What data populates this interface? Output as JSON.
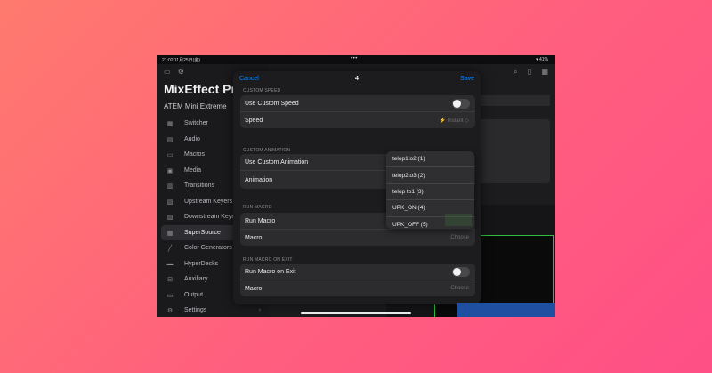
{
  "status_bar": {
    "time": "21:02  11月25日(金)",
    "dots": "•••",
    "indicators": "▾ 41%"
  },
  "sidebar": {
    "icons": [
      "sidebar-toggle-icon",
      "settings-icon"
    ],
    "app_title": "MixEffect Pro",
    "device_name": "ATEM Mini Extreme",
    "items": [
      {
        "label": "Switcher",
        "icon": "switcher-icon"
      },
      {
        "label": "Audio",
        "icon": "audio-icon"
      },
      {
        "label": "Macros",
        "icon": "macros-icon"
      },
      {
        "label": "Media",
        "icon": "media-icon"
      },
      {
        "label": "Transitions",
        "icon": "transitions-icon"
      },
      {
        "label": "Upstream Keyers",
        "icon": "upstream-keyers-icon"
      },
      {
        "label": "Downstream Keyers",
        "icon": "downstream-keyers-icon"
      },
      {
        "label": "SuperSource",
        "icon": "supersource-icon",
        "active": true
      },
      {
        "label": "Color Generators",
        "icon": "color-generators-icon"
      },
      {
        "label": "HyperDecks",
        "icon": "hyperdecks-icon"
      },
      {
        "label": "Auxiliary",
        "icon": "auxiliary-icon"
      },
      {
        "label": "Output",
        "icon": "output-icon"
      },
      {
        "label": "Settings",
        "icon": "settings-icon"
      }
    ]
  },
  "sheet": {
    "cancel_label": "Cancel",
    "title": "4",
    "save_label": "Save",
    "custom_speed": {
      "section_label": "CUSTOM SPEED",
      "use_label": "Use Custom Speed",
      "speed_label": "Speed",
      "speed_value": "Instant ◇"
    },
    "custom_animation": {
      "section_label": "CUSTOM ANIMATION",
      "use_label": "Use Custom Animation",
      "animation_label": "Animation"
    },
    "run_macro": {
      "section_label": "RUN MACRO",
      "run_label": "Run Macro",
      "macro_label": "Macro",
      "macro_value": "Choose"
    },
    "run_macro_exit": {
      "section_label": "RUN MACRO ON EXIT",
      "run_label": "Run Macro on Exit",
      "macro_label": "Macro",
      "macro_value": "Choose"
    }
  },
  "dropdown": {
    "options": [
      "telop1to2 (1)",
      "telop2to3 (2)",
      "telop to1 (3)",
      "UPK_ON (4)",
      "UPK_OFF (5)"
    ]
  },
  "colors": {
    "accent": "#0a84ff",
    "active_green": "#2fbf3a",
    "alert_red": "#a01d22"
  }
}
